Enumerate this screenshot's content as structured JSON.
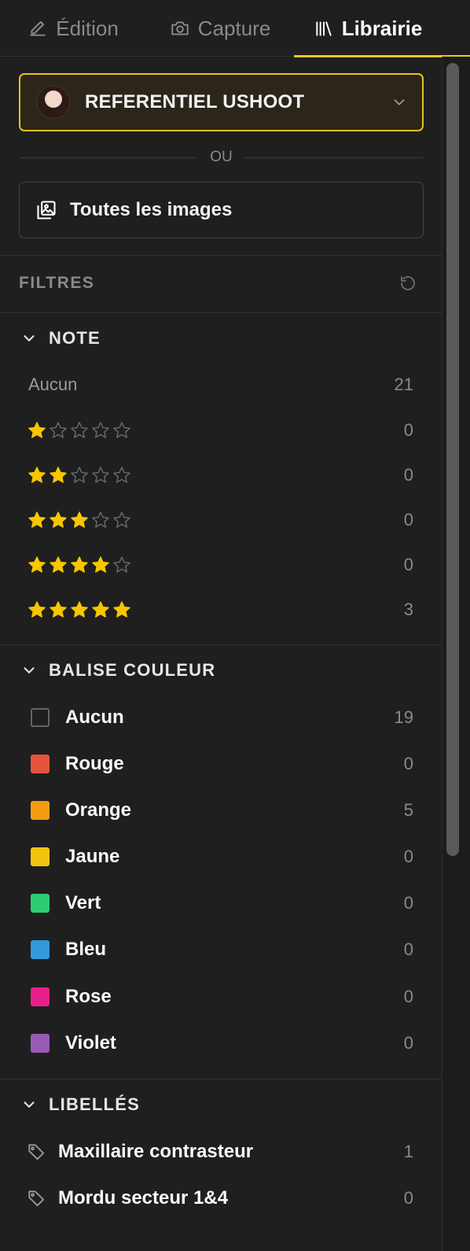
{
  "tabs": [
    {
      "label": "Édition",
      "icon": "pencil-icon"
    },
    {
      "label": "Capture",
      "icon": "camera-icon"
    },
    {
      "label": "Librairie",
      "icon": "library-icon"
    }
  ],
  "selector": {
    "label": "REFERENTIEL USHOOT"
  },
  "or_label": "OU",
  "all_images_label": "Toutes les images",
  "filters": {
    "title": "FILTRES"
  },
  "note": {
    "title": "NOTE",
    "rows": [
      {
        "label": "Aucun",
        "stars": 0,
        "count": "21"
      },
      {
        "stars": 1,
        "count": "0"
      },
      {
        "stars": 2,
        "count": "0"
      },
      {
        "stars": 3,
        "count": "0"
      },
      {
        "stars": 4,
        "count": "0"
      },
      {
        "stars": 5,
        "count": "3"
      }
    ]
  },
  "color_tag": {
    "title": "BALISE COULEUR",
    "rows": [
      {
        "label": "Aucun",
        "color": "",
        "count": "19"
      },
      {
        "label": "Rouge",
        "color": "#e5533d",
        "count": "0"
      },
      {
        "label": "Orange",
        "color": "#f39c12",
        "count": "5"
      },
      {
        "label": "Jaune",
        "color": "#f1c40f",
        "count": "0"
      },
      {
        "label": "Vert",
        "color": "#2ecc71",
        "count": "0"
      },
      {
        "label": "Bleu",
        "color": "#3498db",
        "count": "0"
      },
      {
        "label": "Rose",
        "color": "#e91e8c",
        "count": "0"
      },
      {
        "label": "Violet",
        "color": "#9b59b6",
        "count": "0"
      }
    ]
  },
  "labels": {
    "title": "LIBELLÉS",
    "rows": [
      {
        "label": "Maxillaire contrasteur",
        "count": "1"
      },
      {
        "label": "Mordu secteur 1&4",
        "count": "0"
      }
    ]
  },
  "colors": {
    "accent": "#f5c518",
    "star_filled": "#f7c600",
    "star_empty": "#6b6b6b"
  }
}
